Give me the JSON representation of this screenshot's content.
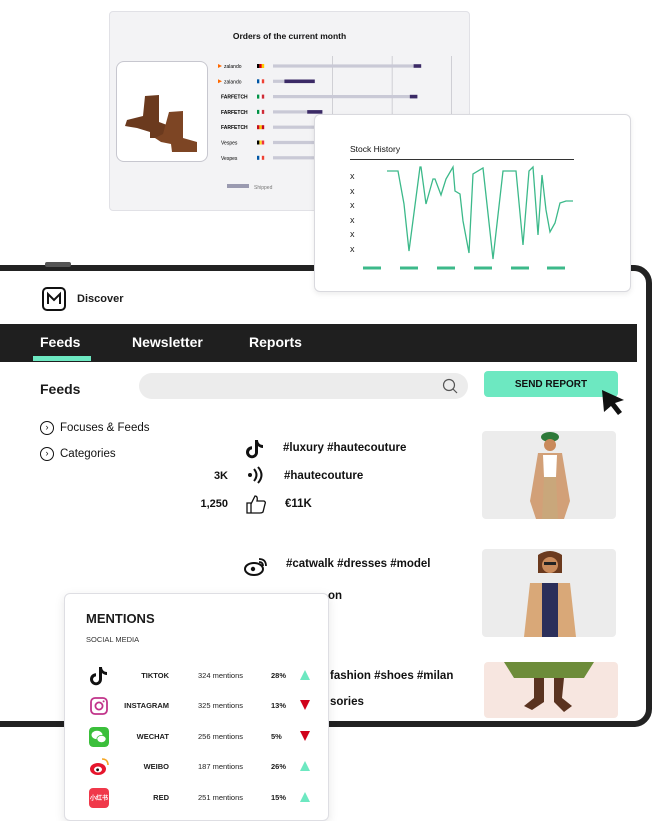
{
  "orders_card": {
    "title": "Orders of the current month",
    "retailers": [
      {
        "name": "zalando",
        "flag": "de",
        "shipped": 0.74,
        "pending": 0.04
      },
      {
        "name": "zalando",
        "flag": "fr",
        "shipped": 0.06,
        "pending": 0.16
      },
      {
        "name": "FARFETCH",
        "flag": "it",
        "shipped": 0.72,
        "pending": 0.04
      },
      {
        "name": "FARFETCH",
        "flag": "it",
        "shipped": 0.18,
        "pending": 0.08
      },
      {
        "name": "FARFETCH",
        "flag": "es",
        "shipped": 0.62,
        "pending": 0.05
      },
      {
        "name": "Vespes",
        "flag": "be",
        "shipped": 0.44,
        "pending": 0.0
      },
      {
        "name": "Vespes",
        "flag": "fr",
        "shipped": 0.44,
        "pending": 0.0
      }
    ],
    "legend_shipped": "Shipped"
  },
  "stock_card": {
    "title": "Stock History",
    "y_ticks": [
      "x",
      "x",
      "x",
      "x",
      "x",
      "x"
    ]
  },
  "app": {
    "name": "Discover",
    "tabs": [
      {
        "label": "Feeds",
        "active": true
      },
      {
        "label": "Newsletter",
        "active": false
      },
      {
        "label": "Reports",
        "active": false
      }
    ],
    "section_title": "Feeds",
    "search_placeholder": "",
    "send_report_label": "SEND REPORT",
    "side_links": [
      "Focuses & Feeds",
      "Categories"
    ]
  },
  "feeds": [
    {
      "network": "tiktok-icon",
      "tags": "#luxury #hautecouture",
      "reach": "3K",
      "reach_tag": "#hautecouture",
      "likes": "1,250",
      "value": "€11K"
    },
    {
      "network": "weibo-icon",
      "tags": "#catwalk #dresses #model",
      "reach_tag": "on"
    },
    {
      "tags": "fashion #shoes #milan",
      "reach_tag": "sories"
    }
  ],
  "mentions": {
    "title": "MENTIONS",
    "subtitle": "SOCIAL MEDIA",
    "rows": [
      {
        "name": "TIKTOK",
        "count": "324 mentions",
        "pct": "28%",
        "trend": "up",
        "color": "#ffffff"
      },
      {
        "name": "INSTAGRAM",
        "count": "325 mentions",
        "pct": "13%",
        "trend": "down",
        "color": "#ffffff"
      },
      {
        "name": "WECHAT",
        "count": "256 mentions",
        "pct": "5%",
        "trend": "down",
        "color": "#3bbf3b"
      },
      {
        "name": "WEIBO",
        "count": "187 mentions",
        "pct": "26%",
        "trend": "up",
        "color": "#ffffff"
      },
      {
        "name": "RED",
        "count": "251 mentions",
        "pct": "15%",
        "trend": "up",
        "color": "#f0384a",
        "icon_text": "小红书"
      }
    ]
  },
  "colors": {
    "accent": "#6de8c1",
    "nav": "#1f1f1f",
    "down": "#d0021b",
    "up": "#6de8c1"
  }
}
